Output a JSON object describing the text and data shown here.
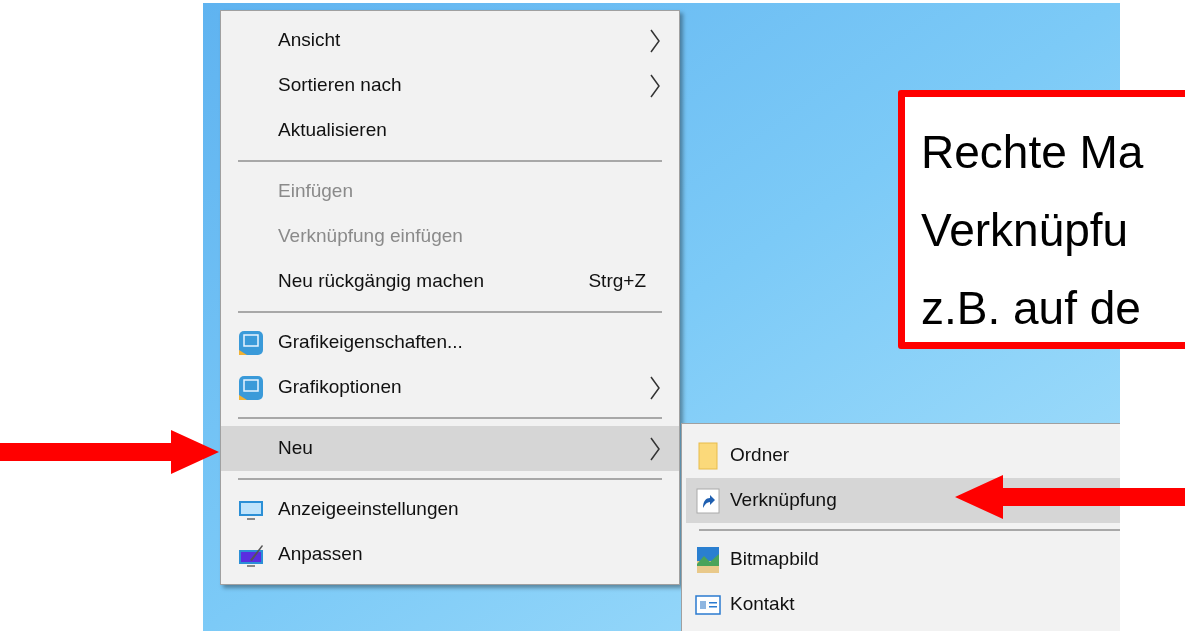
{
  "context_menu": {
    "items": [
      {
        "kind": "item",
        "label": "Ansicht",
        "submenu": true,
        "disabled": false,
        "selected": false
      },
      {
        "kind": "item",
        "label": "Sortieren nach",
        "submenu": true,
        "disabled": false,
        "selected": false
      },
      {
        "kind": "item",
        "label": "Aktualisieren",
        "submenu": false,
        "disabled": false,
        "selected": false
      },
      {
        "kind": "separator"
      },
      {
        "kind": "item",
        "label": "Einfügen",
        "submenu": false,
        "disabled": true,
        "selected": false
      },
      {
        "kind": "item",
        "label": "Verknüpfung einfügen",
        "submenu": false,
        "disabled": true,
        "selected": false
      },
      {
        "kind": "item",
        "label": "Neu rückgängig machen",
        "shortcut": "Strg+Z",
        "submenu": false,
        "disabled": false,
        "selected": false
      },
      {
        "kind": "separator"
      },
      {
        "kind": "item",
        "label": "Grafikeigenschaften...",
        "submenu": false,
        "disabled": false,
        "selected": false
      },
      {
        "kind": "item",
        "label": "Grafikoptionen",
        "submenu": true,
        "disabled": false,
        "selected": false
      },
      {
        "kind": "separator"
      },
      {
        "kind": "item",
        "label": "Neu",
        "submenu": true,
        "disabled": false,
        "selected": true
      },
      {
        "kind": "separator"
      },
      {
        "kind": "item",
        "label": "Anzeigeeinstellungen",
        "submenu": false,
        "disabled": false,
        "selected": false
      },
      {
        "kind": "item",
        "label": "Anpassen",
        "submenu": false,
        "disabled": false,
        "selected": false
      }
    ]
  },
  "submenu": {
    "items": [
      {
        "kind": "item",
        "label": "Ordner",
        "selected": false
      },
      {
        "kind": "item",
        "label": "Verknüpfung",
        "selected": true
      },
      {
        "kind": "separator"
      },
      {
        "kind": "item",
        "label": "Bitmapbild",
        "selected": false
      },
      {
        "kind": "item",
        "label": "Kontakt",
        "selected": false
      }
    ]
  },
  "callout": {
    "lines": [
      "Rechte Ma",
      "Verknüpfu",
      "z.B. auf de"
    ]
  }
}
